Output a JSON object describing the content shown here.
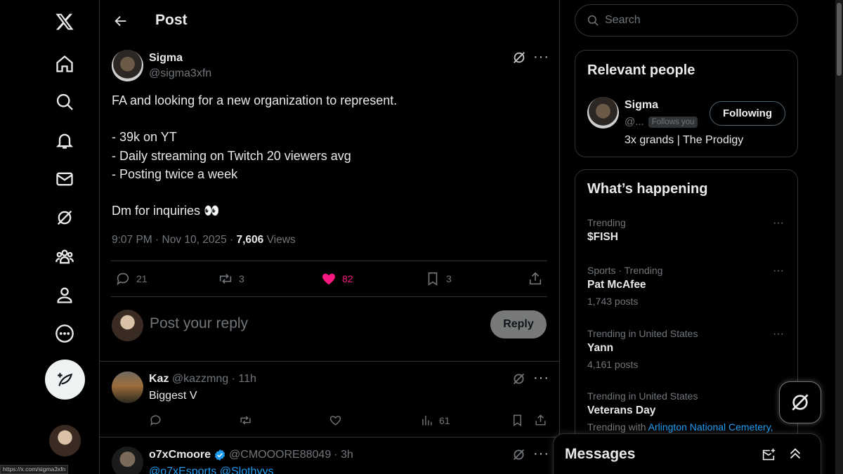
{
  "header": {
    "title": "Post"
  },
  "post": {
    "author_name": "Sigma",
    "author_handle": "@sigma3xfn",
    "lines": [
      "FA and looking for a new organization to represent.",
      "",
      "- 39k on YT",
      "- Daily streaming on Twitch 20 viewers avg",
      "- Posting twice a week",
      "",
      "Dm for inquiries 👀"
    ],
    "time": "9:07 PM · Nov 10, 2025 · ",
    "views_count": "7,606",
    "views_label": " Views",
    "stats": {
      "replies": "21",
      "reposts": "3",
      "likes": "82",
      "bookmarks": "3"
    }
  },
  "reply_box": {
    "placeholder": "Post your reply",
    "button": "Reply"
  },
  "replies": [
    {
      "name": "Kaz",
      "handle": "@kazzmng",
      "time": "· 11h",
      "text": "Biggest V",
      "views": "61"
    },
    {
      "name": "o7xCmoore",
      "handle": "@CMOOORE88049",
      "time": "· 3h",
      "text": "@o7xEsports @Slothyys"
    }
  ],
  "sidebar": {
    "search_placeholder": "Search",
    "relevant": {
      "title": "Relevant people",
      "name": "Sigma",
      "handle": "@...",
      "follows_you": "Follows you",
      "follow_button": "Following",
      "bio": "3x grands | The Prodigy"
    },
    "happening": {
      "title": "What’s happening",
      "trends": [
        {
          "context": "Trending",
          "title": "$FISH",
          "count": ""
        },
        {
          "context": "Sports · Trending",
          "title": "Pat McAfee",
          "count": "1,743 posts"
        },
        {
          "context": "Trending in United States",
          "title": "Yann",
          "count": "4,161 posts"
        },
        {
          "context": "Trending in United States",
          "title": "Veterans Day",
          "count": "Trending with ",
          "link": "Arlington National Cemetery,"
        }
      ]
    }
  },
  "messages": {
    "title": "Messages"
  },
  "status_url": "https://x.com/sigma3xfn",
  "colors": {
    "like": "#f91880",
    "link": "#1d9bf0",
    "verified": "#1d9bf0"
  },
  "icons": [
    "x-logo-icon",
    "home-icon",
    "search-icon",
    "bell-icon",
    "mail-icon",
    "grok-icon",
    "communities-icon",
    "profile-icon",
    "more-icon",
    "compose-icon",
    "back-arrow-icon",
    "reply-icon",
    "repost-icon",
    "heart-icon",
    "bookmark-icon",
    "share-icon",
    "analytics-icon",
    "verified-icon",
    "new-message-icon",
    "chevron-up-icon"
  ]
}
